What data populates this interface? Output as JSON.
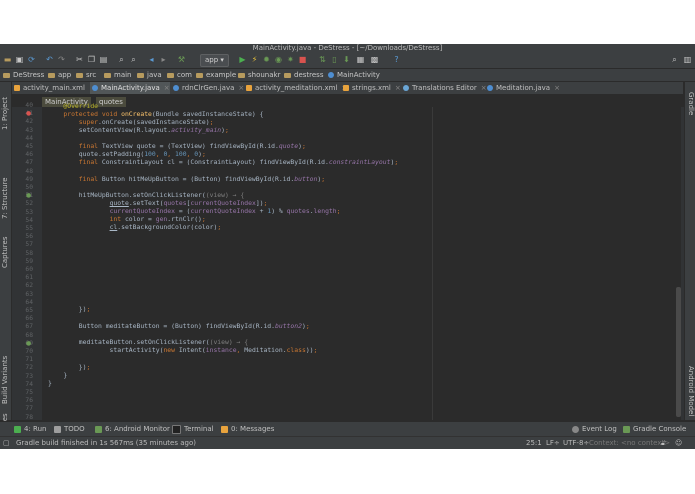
{
  "window": {
    "title": "MainActivity.java - DeStress - [~/Downloads/DeStress]"
  },
  "nav_breadcrumbs": [
    "DeStress",
    "app",
    "src",
    "main",
    "java",
    "com",
    "example",
    "shounakr",
    "destress",
    "MainActivity"
  ],
  "toolbar": {
    "run_config": "app"
  },
  "tabs": [
    {
      "label": "activity_main.xml",
      "icon": "xml-file-icon",
      "color": "#e8a33d"
    },
    {
      "label": "MainActivity.java",
      "icon": "class-icon",
      "color": "#4e8ed1"
    },
    {
      "label": "rdnClrGen.java",
      "icon": "class-icon",
      "color": "#4e8ed1"
    },
    {
      "label": "activity_meditation.xml",
      "icon": "xml-file-icon",
      "color": "#e8a33d"
    },
    {
      "label": "strings.xml",
      "icon": "xml-file-icon",
      "color": "#e8a33d"
    },
    {
      "label": "Translations Editor",
      "icon": "globe-icon",
      "color": "#6aa6d6"
    },
    {
      "label": "Meditation.java",
      "icon": "class-icon",
      "color": "#4e8ed1"
    }
  ],
  "editor_breadcrumbs": [
    "MainActivity",
    "quotes"
  ],
  "left_tool_windows": [
    "1: Project",
    "7: Structure",
    "Captures",
    "Build Variants",
    "2: Favorites"
  ],
  "right_tool_windows": [
    "Gradle",
    "Android Model"
  ],
  "line_numbers": [
    "40",
    "41",
    "42",
    "43",
    "44",
    "45",
    "46",
    "47",
    "48",
    "49",
    "50",
    "51",
    "52",
    "53",
    "54",
    "55",
    "56",
    "57",
    "58",
    "59",
    "60",
    "61",
    "62",
    "63",
    "64",
    "65",
    "66",
    "67",
    "68",
    "69",
    "70",
    "71",
    "72",
    "73",
    "74",
    "75",
    "76",
    "77",
    "78"
  ],
  "bottom_tools": [
    {
      "label": "4: Run",
      "icon": "run-icon"
    },
    {
      "label": "TODO",
      "icon": "todo-icon"
    },
    {
      "label": "6: Android Monitor",
      "icon": "android-monitor-icon"
    },
    {
      "label": "Terminal",
      "icon": "terminal-icon"
    },
    {
      "label": "0: Messages",
      "icon": "messages-icon"
    }
  ],
  "bottom_tools_right": [
    {
      "label": "Event Log",
      "icon": "event-log-icon"
    },
    {
      "label": "Gradle Console",
      "icon": "gradle-console-icon"
    }
  ],
  "status": {
    "message": "Gradle build finished in 1s 567ms (35 minutes ago)",
    "position": "25:1",
    "line_sep": "LF÷",
    "encoding": "UTF-8÷",
    "context": "Context: <no context>"
  },
  "colors": {
    "editor_bg": "#2b2b2b",
    "chrome": "#3c3f41",
    "keyword": "#cc7832",
    "field": "#9876aa",
    "method": "#ffc66d",
    "number": "#6897bb"
  }
}
